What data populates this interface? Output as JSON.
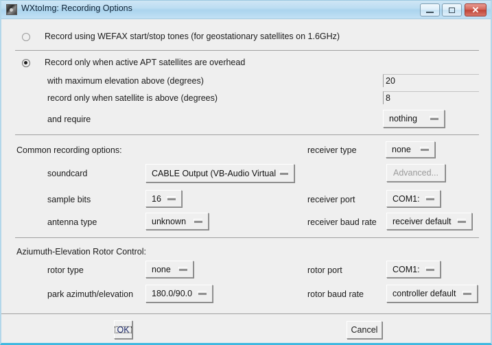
{
  "window": {
    "title": "WXtoImg: Recording Options",
    "icon": "app-icon",
    "controls": {
      "minimize": "minimize-icon",
      "maximize": "maximize-icon",
      "close": "✕"
    }
  },
  "mode": {
    "wefax": {
      "label": "Record using WEFAX start/stop tones (for geostationary satellites on 1.6GHz)",
      "selected": false
    },
    "apt": {
      "label": "Record only when active APT satellites are overhead",
      "selected": true
    }
  },
  "apt_options": {
    "max_elevation": {
      "label": "with maximum elevation above (degrees)",
      "value": "20"
    },
    "min_elevation": {
      "label": "record only when satellite is above (degrees)",
      "value": "8"
    },
    "require": {
      "label": "and require",
      "value": "nothing"
    }
  },
  "common": {
    "heading": "Common recording options:",
    "soundcard": {
      "label": "soundcard",
      "value": "CABLE Output (VB-Audio Virtual"
    },
    "sample_bits": {
      "label": "sample bits",
      "value": "16"
    },
    "antenna_type": {
      "label": "antenna type",
      "value": "unknown"
    },
    "receiver_type": {
      "label": "receiver type",
      "value": "none"
    },
    "advanced": {
      "label": "Advanced...",
      "enabled": false
    },
    "receiver_port": {
      "label": "receiver port",
      "value": "COM1:"
    },
    "receiver_baud": {
      "label": "receiver baud rate",
      "value": "receiver default"
    }
  },
  "rotor": {
    "heading": "Aziumuth-Elevation Rotor Control:",
    "rotor_type": {
      "label": "rotor type",
      "value": "none"
    },
    "park": {
      "label": "park azimuth/elevation",
      "value": "180.0/90.0"
    },
    "rotor_port": {
      "label": "rotor port",
      "value": "COM1:"
    },
    "rotor_baud": {
      "label": "rotor baud rate",
      "value": "controller default"
    }
  },
  "footer": {
    "ok": "OK",
    "cancel": "Cancel"
  },
  "colors": {
    "face": "#efefef",
    "title_bar": "#bcddf2",
    "accent_border": "#3fb8e0",
    "close_button": "#bf4436",
    "disabled_text": "#9b9b9b"
  }
}
